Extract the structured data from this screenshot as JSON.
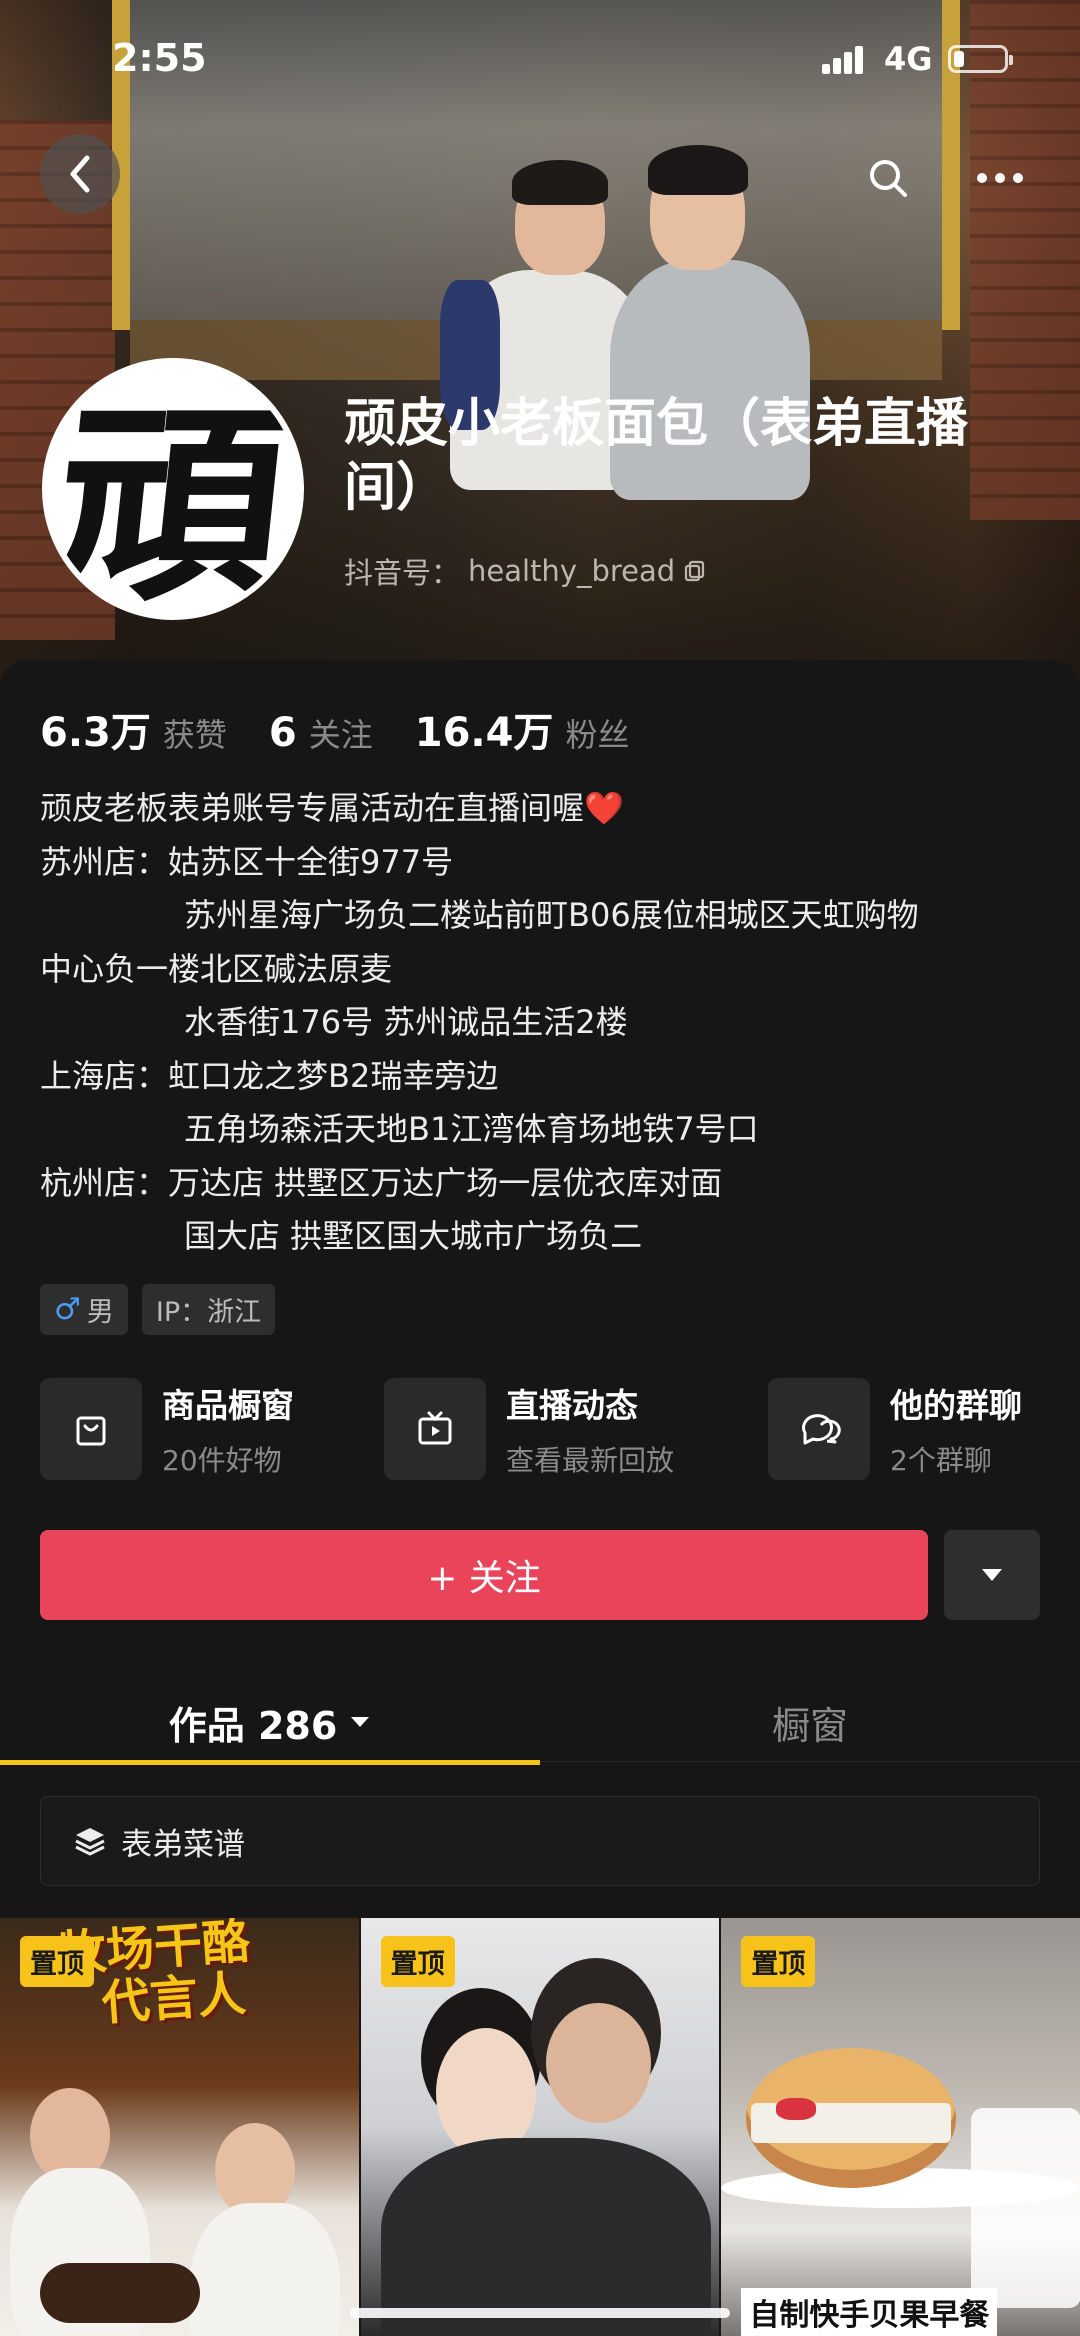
{
  "status_bar": {
    "time": "2:55",
    "network": "4G",
    "battery_level": 0.2
  },
  "header": {
    "profile_name": "顽皮小老板面包（表弟直播间）",
    "douyin_id_label": "抖音号：",
    "douyin_id": "healthy_bread",
    "avatar_glyph": "頑"
  },
  "stats": [
    {
      "value": "6.3万",
      "label": "获赞"
    },
    {
      "value": "6",
      "label": "关注"
    },
    {
      "value": "16.4万",
      "label": "粉丝"
    }
  ],
  "bio": {
    "intro": "顽皮老板表弟账号专属活动在直播间喔",
    "heart": "❤️",
    "lines": [
      {
        "prefix": "苏州店：",
        "text": "姑苏区十全街977号"
      },
      {
        "prefix": "",
        "text": "苏州星海广场负二楼站前町B06展位相城区天虹购物"
      },
      {
        "prefix": "wrap",
        "text": "中心负一楼北区碱法原麦"
      },
      {
        "prefix": "",
        "text": "水香街176号 苏州诚品生活2楼"
      },
      {
        "prefix": "上海店：",
        "text": "虹口龙之梦B2瑞幸旁边"
      },
      {
        "prefix": "",
        "text": "五角场森活天地B1江湾体育场地铁7号口"
      },
      {
        "prefix": "杭州店：",
        "text": "万达店 拱墅区万达广场一层优衣库对面"
      },
      {
        "prefix": "",
        "text": "国大店 拱墅区国大城市广场负二"
      }
    ]
  },
  "tags": {
    "gender_symbol": "♂",
    "gender": "男",
    "ip": "IP：浙江"
  },
  "features": [
    {
      "title": "商品橱窗",
      "subtitle": "20件好物",
      "icon": "shopping-bag-icon"
    },
    {
      "title": "直播动态",
      "subtitle": "查看最新回放",
      "icon": "tv-icon"
    },
    {
      "title": "他的群聊",
      "subtitle": "2个群聊",
      "icon": "chat-bubbles-icon"
    }
  ],
  "actions": {
    "follow_label": "+ 关注",
    "follow_color": "#e9445a"
  },
  "tabs": {
    "works_label": "作品 286",
    "showcase_label": "橱窗",
    "active_color": "#f5c518"
  },
  "collection": {
    "label": "表弟菜谱"
  },
  "videos": [
    {
      "pin": "置顶",
      "overlay_title_1": "牧场干酪",
      "overlay_title_2": "代言人"
    },
    {
      "pin": "置顶"
    },
    {
      "pin": "置顶",
      "caption": "自制快手贝果早餐"
    }
  ]
}
